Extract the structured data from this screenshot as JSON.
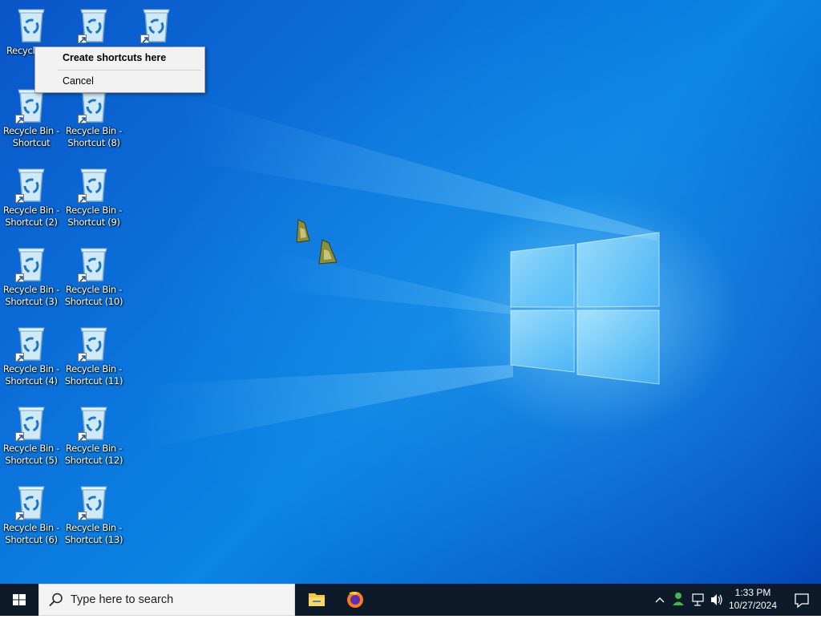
{
  "desktop": {
    "icons": [
      {
        "label": "Recycle Bin",
        "shortcut": false
      },
      {
        "label": "",
        "shortcut": true
      },
      {
        "label": "",
        "shortcut": true
      },
      {
        "label": "Recycle Bin - Shortcut",
        "shortcut": true
      },
      {
        "label": "Recycle Bin - Shortcut (2)",
        "shortcut": true
      },
      {
        "label": "Recycle Bin - Shortcut (3)",
        "shortcut": true
      },
      {
        "label": "Recycle Bin - Shortcut (4)",
        "shortcut": true
      },
      {
        "label": "Recycle Bin - Shortcut (5)",
        "shortcut": true
      },
      {
        "label": "Recycle Bin - Shortcut (6)",
        "shortcut": true
      },
      {
        "label": "Recycle Bin - Shortcut (8)",
        "shortcut": true
      },
      {
        "label": "Recycle Bin - Shortcut (9)",
        "shortcut": true
      },
      {
        "label": "Recycle Bin - Shortcut (10)",
        "shortcut": true
      },
      {
        "label": "Recycle Bin - Shortcut (11)",
        "shortcut": true
      },
      {
        "label": "Recycle Bin - Shortcut (12)",
        "shortcut": true
      },
      {
        "label": "Recycle Bin - Shortcut (13)",
        "shortcut": true
      }
    ],
    "partial_icon_label": "Recycl"
  },
  "context_menu": {
    "items": [
      {
        "label": "Create shortcuts here",
        "bold": true
      },
      {
        "label": "Cancel",
        "bold": false
      }
    ]
  },
  "taskbar": {
    "search_placeholder": "Type here to search",
    "pinned_apps": [
      "file-explorer-icon",
      "firefox-icon"
    ],
    "clock": {
      "time": "1:33 PM",
      "date": "10/27/2024"
    }
  },
  "colors": {
    "taskbar_bg": "#0c1a2a",
    "desktop_blue": "#0a78dc",
    "menu_bg": "#f2f2f2"
  }
}
